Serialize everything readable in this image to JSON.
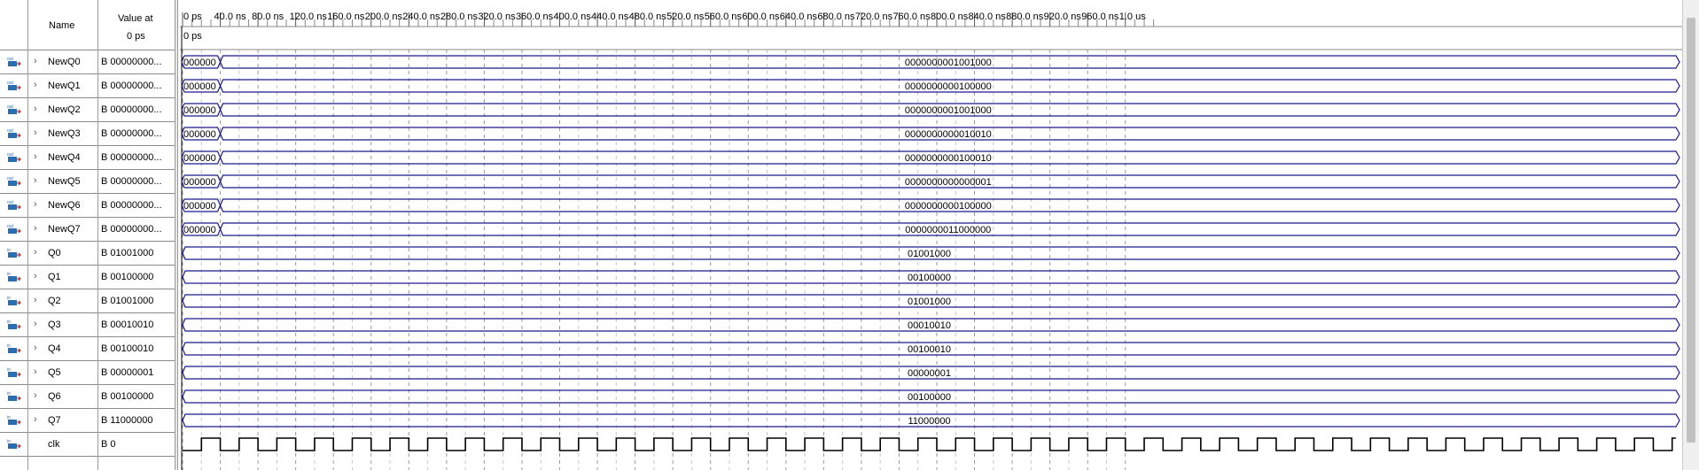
{
  "header": {
    "name_label": "Name",
    "value_label_line1": "Value at",
    "value_label_line2": "0 ps",
    "cursor_label": "0 ps"
  },
  "timeline": {
    "ticks": [
      "0 ps",
      "40.0 ns",
      "80.0 ns",
      "120.0 ns",
      "160.0 ns",
      "200.0 ns",
      "240.0 ns",
      "280.0 ns",
      "320.0 ns",
      "360.0 ns",
      "400.0 ns",
      "440.0 ns",
      "480.0 ns",
      "520.0 ns",
      "560.0 ns",
      "600.0 ns",
      "640.0 ns",
      "680.0 ns",
      "720.0 ns",
      "760.0 ns",
      "800.0 ns",
      "840.0 ns",
      "880.0 ns",
      "920.0 ns",
      "960.0 ns",
      "1.0 us"
    ]
  },
  "signals": [
    {
      "name": "NewQ0",
      "dir": "out",
      "value": "B 00000000...",
      "initial": "000000",
      "wave": "0000000001001000"
    },
    {
      "name": "NewQ1",
      "dir": "out",
      "value": "B 00000000...",
      "initial": "000000",
      "wave": "0000000000100000"
    },
    {
      "name": "NewQ2",
      "dir": "out",
      "value": "B 00000000...",
      "initial": "000000",
      "wave": "0000000001001000"
    },
    {
      "name": "NewQ3",
      "dir": "out",
      "value": "B 00000000...",
      "initial": "000000",
      "wave": "0000000000010010"
    },
    {
      "name": "NewQ4",
      "dir": "out",
      "value": "B 00000000...",
      "initial": "000000",
      "wave": "0000000000100010"
    },
    {
      "name": "NewQ5",
      "dir": "out",
      "value": "B 00000000...",
      "initial": "000000",
      "wave": "0000000000000001"
    },
    {
      "name": "NewQ6",
      "dir": "out",
      "value": "B 00000000...",
      "initial": "000000",
      "wave": "0000000000100000"
    },
    {
      "name": "NewQ7",
      "dir": "out",
      "value": "B 00000000...",
      "initial": "000000",
      "wave": "0000000011000000"
    },
    {
      "name": "Q0",
      "dir": "in",
      "value": "B 01001000",
      "initial": "",
      "wave": "01001000"
    },
    {
      "name": "Q1",
      "dir": "in",
      "value": "B 00100000",
      "initial": "",
      "wave": "00100000"
    },
    {
      "name": "Q2",
      "dir": "in",
      "value": "B 01001000",
      "initial": "",
      "wave": "01001000"
    },
    {
      "name": "Q3",
      "dir": "in",
      "value": "B 00010010",
      "initial": "",
      "wave": "00010010"
    },
    {
      "name": "Q4",
      "dir": "in",
      "value": "B 00100010",
      "initial": "",
      "wave": "00100010"
    },
    {
      "name": "Q5",
      "dir": "in",
      "value": "B 00000001",
      "initial": "",
      "wave": "00000001"
    },
    {
      "name": "Q6",
      "dir": "in",
      "value": "B 00100000",
      "initial": "",
      "wave": "00100000"
    },
    {
      "name": "Q7",
      "dir": "in",
      "value": "B 11000000",
      "initial": "",
      "wave": "11000000"
    },
    {
      "name": "clk",
      "dir": "in",
      "value": "B 0",
      "initial": "",
      "wave": "clock"
    }
  ],
  "colors": {
    "bus": "#1a1a8c",
    "clock": "#000000",
    "grid": "#9a9a9a",
    "icon_out": "#2a6db0",
    "icon_in": "#2a6db0",
    "icon_arrow": "#c03030"
  }
}
